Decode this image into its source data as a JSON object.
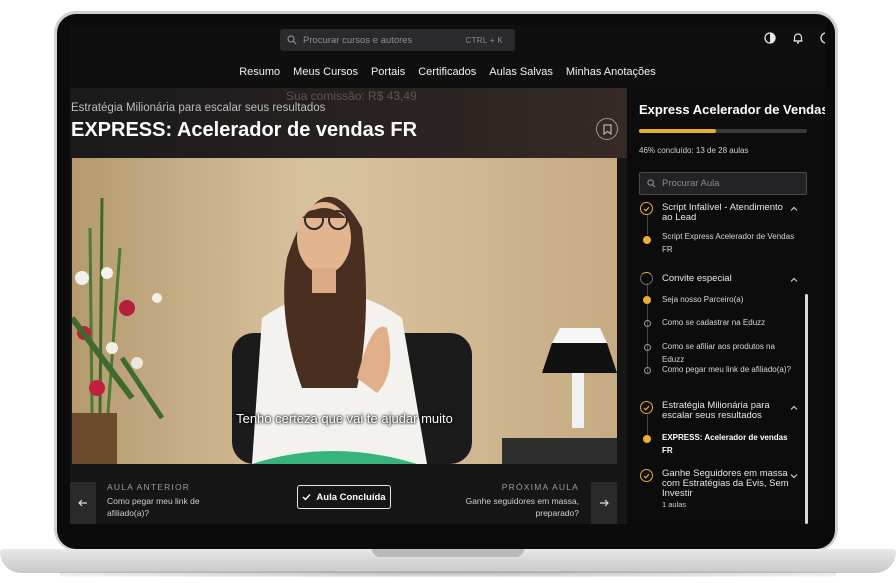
{
  "topbar": {
    "search_placeholder": "Procurar cursos e autores",
    "search_shortcut": "CTRL + K",
    "icons": [
      "theme-toggle-icon",
      "bell-icon",
      "profile-icon"
    ]
  },
  "nav": {
    "items": [
      "Resumo",
      "Meus Cursos",
      "Portais",
      "Certificados",
      "Aulas Salvas",
      "Minhas Anotações"
    ]
  },
  "lesson": {
    "module_title": "Estratégia Milionária para escalar seus resultados",
    "title": "EXPRESS: Acelerador de vendas FR",
    "background_text": "Sua comissão: R$ 43,49",
    "video_caption": "Tenho certeza que vai te ajudar muito"
  },
  "footer": {
    "prev_label": "AULA ANTERIOR",
    "prev_text": "Como pegar meu link de afiliado(a)?",
    "done_label": "Aula Concluída",
    "next_label": "PRÓXIMA AULA",
    "next_text": "Ganhe seguidores em massa, preparado?"
  },
  "sidebar": {
    "course_title": "Express Acelerador de Vendas",
    "progress_fraction": 0.46,
    "progress_text": "46% concluído: 13 de 28 aulas",
    "search_placeholder": "Procurar Aula",
    "modules": [
      {
        "title": "Script Infalível - Atendimento ao Lead",
        "status": "done",
        "lessons": [
          {
            "title": "Script Express Acelerador de Vendas FR",
            "status": "done"
          }
        ]
      },
      {
        "title": "Convite especial",
        "status": "in-progress",
        "lessons": [
          {
            "title": "Seja nosso Parceiro(a)",
            "status": "done"
          },
          {
            "title": "Como se cadastrar na Eduzz",
            "status": "todo"
          },
          {
            "title": "Como se afiliar aos produtos na Eduzz",
            "status": "todo"
          },
          {
            "title": "Como pegar meu link de afiliado(a)?",
            "status": "todo"
          }
        ]
      },
      {
        "title": "Estratégia Milionária para escalar seus resultados",
        "status": "done",
        "lessons": [
          {
            "title": "EXPRESS: Acelerador de vendas FR",
            "status": "current"
          }
        ]
      },
      {
        "title": "Ganhe Seguidores em massa com Estratégias da Evis, Sem Investir",
        "status": "done",
        "meta": "1 aulas"
      }
    ]
  },
  "colors": {
    "accent": "#e8b02d",
    "background": "#151516",
    "sidebar": "#0c0c0d"
  }
}
